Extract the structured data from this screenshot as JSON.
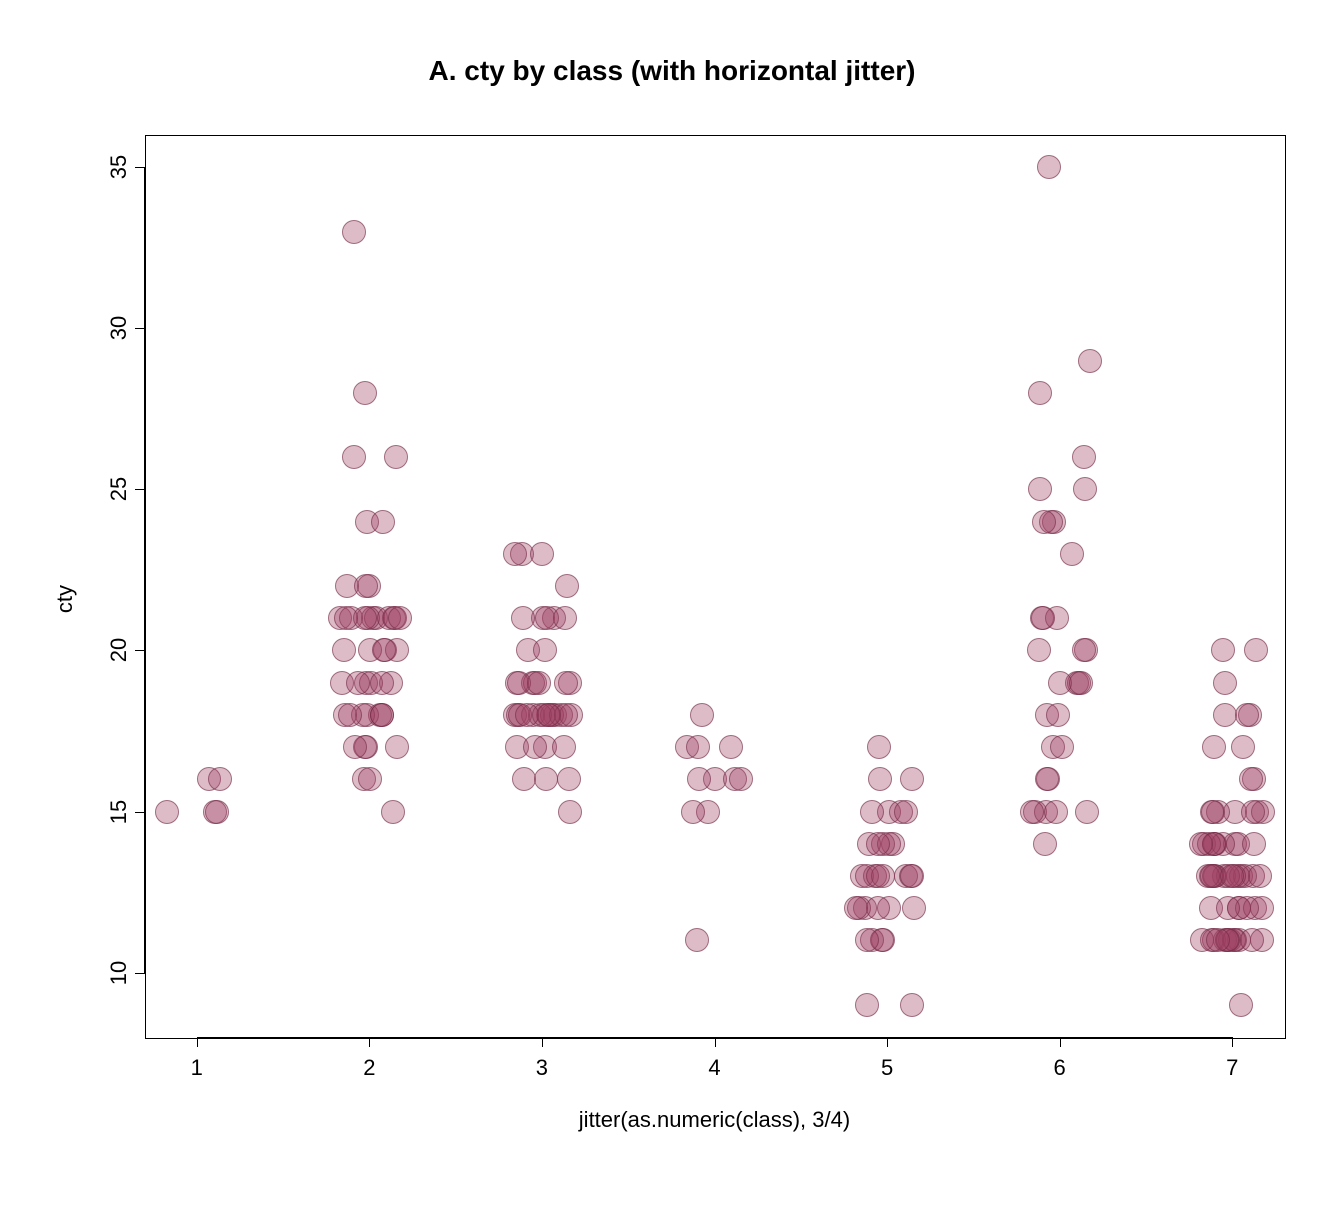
{
  "chart_data": {
    "type": "scatter",
    "title": "A. cty by class (with horizontal jitter)",
    "xlabel": "jitter(as.numeric(class), 3/4)",
    "ylabel": "cty",
    "xlim": [
      0.7,
      7.3
    ],
    "ylim": [
      8,
      36
    ],
    "x_ticks": [
      1,
      2,
      3,
      4,
      5,
      6,
      7
    ],
    "y_ticks": [
      10,
      15,
      20,
      25,
      30,
      35
    ],
    "series": [
      {
        "name": "1",
        "x": 1,
        "values": [
          15,
          15,
          16,
          16,
          15
        ]
      },
      {
        "name": "2",
        "x": 2,
        "values": [
          15,
          16,
          16,
          17,
          17,
          17,
          18,
          18,
          18,
          18,
          18,
          19,
          19,
          19,
          19,
          19,
          20,
          20,
          20,
          20,
          21,
          21,
          21,
          21,
          21,
          21,
          21,
          21,
          21,
          21,
          22,
          22,
          22,
          24,
          24,
          26,
          26,
          28,
          33,
          21,
          18,
          19,
          20,
          17,
          18
        ]
      },
      {
        "name": "3",
        "x": 3,
        "values": [
          15,
          16,
          16,
          16,
          17,
          17,
          17,
          17,
          18,
          18,
          18,
          18,
          18,
          18,
          18,
          18,
          18,
          18,
          18,
          18,
          18,
          18,
          19,
          19,
          19,
          19,
          19,
          19,
          19,
          20,
          20,
          21,
          21,
          21,
          21,
          21,
          22,
          23,
          23,
          23
        ]
      },
      {
        "name": "4",
        "x": 4,
        "values": [
          11,
          15,
          15,
          16,
          16,
          16,
          16,
          17,
          17,
          17,
          18
        ]
      },
      {
        "name": "5",
        "x": 5,
        "values": [
          9,
          9,
          11,
          11,
          11,
          11,
          12,
          12,
          12,
          12,
          12,
          12,
          13,
          13,
          13,
          13,
          13,
          13,
          13,
          13,
          14,
          14,
          14,
          14,
          14,
          15,
          15,
          15,
          15,
          16,
          16,
          17
        ]
      },
      {
        "name": "6",
        "x": 6,
        "values": [
          14,
          15,
          15,
          15,
          15,
          15,
          16,
          16,
          17,
          17,
          18,
          18,
          19,
          19,
          19,
          19,
          20,
          20,
          20,
          21,
          21,
          21,
          23,
          24,
          24,
          24,
          25,
          25,
          26,
          28,
          29,
          35
        ]
      },
      {
        "name": "7",
        "x": 7,
        "values": [
          9,
          11,
          11,
          11,
          11,
          11,
          11,
          11,
          11,
          11,
          11,
          11,
          11,
          11,
          12,
          12,
          12,
          12,
          12,
          12,
          12,
          13,
          13,
          13,
          13,
          13,
          13,
          13,
          13,
          13,
          13,
          13,
          13,
          13,
          13,
          14,
          14,
          14,
          14,
          14,
          14,
          14,
          14,
          14,
          14,
          15,
          15,
          15,
          15,
          15,
          15,
          15,
          16,
          16,
          17,
          17,
          18,
          18,
          18,
          19,
          20,
          20
        ]
      }
    ],
    "point_color": "#9e3f62"
  }
}
